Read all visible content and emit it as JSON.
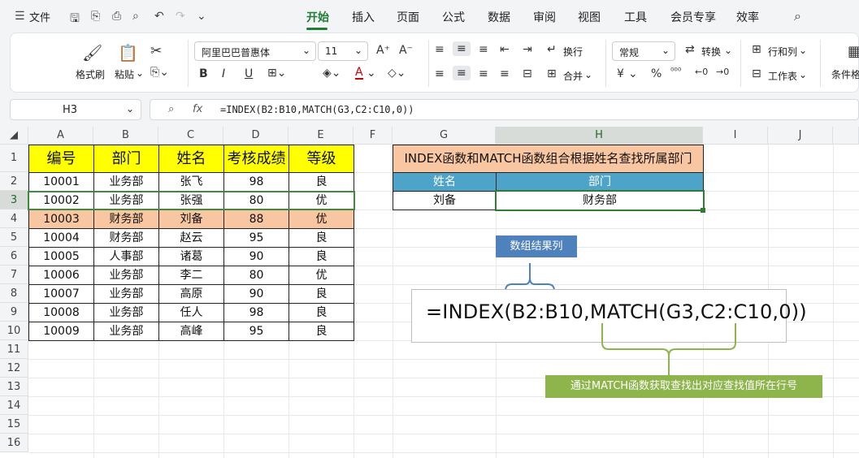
{
  "menu": {
    "file_label": "文件",
    "tabs": [
      "开始",
      "插入",
      "页面",
      "公式",
      "数据",
      "审阅",
      "视图",
      "工具",
      "会员专享",
      "效率"
    ],
    "active_tab": "开始"
  },
  "ribbon": {
    "format_painter": "格式刷",
    "paste": "粘贴",
    "font_name": "阿里巴巴普惠体",
    "font_size": "11",
    "wrap": "换行",
    "merge": "合并",
    "number_format": "常规",
    "convert": "转换",
    "row_col": "行和列",
    "worksheet": "工作表",
    "cond_format": "条件格",
    "bold": "B",
    "italic": "I",
    "underline": "U",
    "font_color_a": "A",
    "currency": "¥",
    "percent": "%"
  },
  "formula_bar": {
    "name_box": "H3",
    "fx": "fx",
    "formula": "=INDEX(B2:B10,MATCH(G3,C2:C10,0))"
  },
  "columns": [
    "A",
    "B",
    "C",
    "D",
    "E",
    "F",
    "G",
    "H",
    "I",
    "J"
  ],
  "rows": [
    "1",
    "2",
    "3",
    "4",
    "5",
    "6",
    "7",
    "8",
    "9",
    "10",
    "11",
    "12",
    "13",
    "14",
    "15",
    "16"
  ],
  "table": {
    "headers": [
      "编号",
      "部门",
      "姓名",
      "考核成绩",
      "等级"
    ],
    "rows": [
      [
        "10001",
        "业务部",
        "张飞",
        "98",
        "良"
      ],
      [
        "10002",
        "业务部",
        "张强",
        "80",
        "优"
      ],
      [
        "10003",
        "财务部",
        "刘备",
        "88",
        "优"
      ],
      [
        "10004",
        "财务部",
        "赵云",
        "95",
        "良"
      ],
      [
        "10005",
        "人事部",
        "诸葛",
        "90",
        "良"
      ],
      [
        "10006",
        "业务部",
        "李二",
        "80",
        "优"
      ],
      [
        "10007",
        "业务部",
        "高原",
        "90",
        "良"
      ],
      [
        "10008",
        "业务部",
        "任人",
        "98",
        "良"
      ],
      [
        "10009",
        "业务部",
        "高峰",
        "95",
        "良"
      ]
    ]
  },
  "lookup": {
    "title": "INDEX函数和MATCH函数组合根据姓名查找所属部门",
    "col1": "姓名",
    "col2": "部门",
    "name": "刘备",
    "dept": "财务部"
  },
  "annotations": {
    "array_label": "数组结果列",
    "formula": "=INDEX(B2:B10,MATCH(G3,C2:C10,0))",
    "match_label": "通过MATCH函数获取查找出对应查找值所在行号"
  },
  "colors": {
    "accent": "#1e7e34",
    "header_yellow": "#ffff00",
    "highlight": "#f8c6a0",
    "lookup_blue": "#4ea3c8",
    "callout_blue": "#4f81bd",
    "callout_green": "#8db54b"
  }
}
